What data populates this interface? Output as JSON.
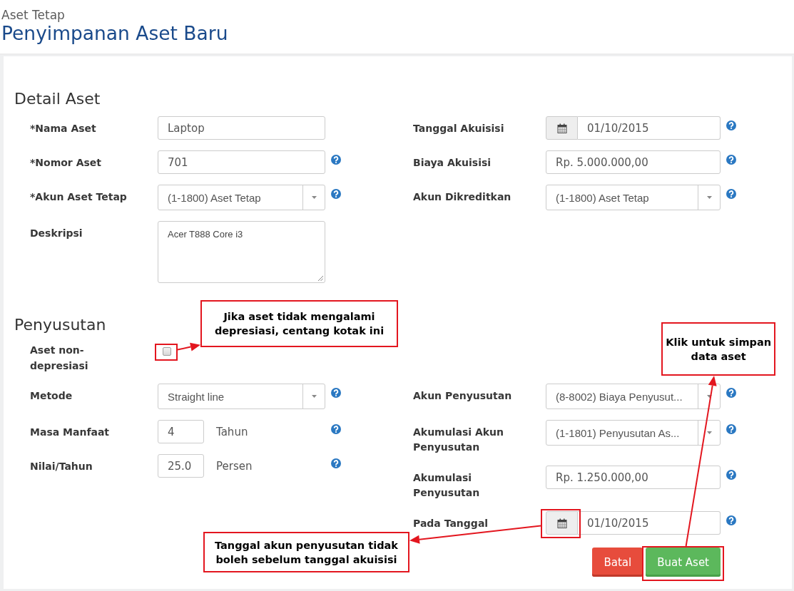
{
  "header": {
    "breadcrumb": "Aset Tetap",
    "title": "Penyimpanan Aset Baru"
  },
  "sections": [
    {
      "title": "Detail Aset",
      "columns": [
        [
          {
            "kind": "text",
            "label": "*Nama Aset",
            "value": "Laptop",
            "help": false
          },
          {
            "kind": "text",
            "label": "*Nomor Aset",
            "value": "701",
            "help": true
          },
          {
            "kind": "select",
            "label": "*Akun Aset Tetap",
            "value": "(1-1800) Aset Tetap",
            "help": true
          },
          {
            "kind": "textarea",
            "label": "Deskripsi",
            "value": "Acer T888 Core i3",
            "help": false
          }
        ],
        [
          {
            "kind": "date",
            "label": "Tanggal Akuisisi",
            "value": "01/10/2015",
            "help": true
          },
          {
            "kind": "text",
            "label": "Biaya Akuisisi",
            "value": "Rp. 5.000.000,00",
            "help": true
          },
          {
            "kind": "select",
            "label": "Akun Dikreditkan",
            "value": "(1-1800) Aset Tetap",
            "help": true
          }
        ]
      ]
    },
    {
      "title": "Penyusutan",
      "toggle": {
        "label": "Aset non-depresiasi",
        "checked": false,
        "callout": "Jika aset tidak mengalami depresiasi, centang kotak ini"
      },
      "columns": [
        [
          {
            "kind": "select",
            "label": "Metode",
            "value": "Straight line",
            "help": true
          },
          {
            "kind": "unit",
            "label": "Masa Manfaat",
            "value": "4",
            "unit": "Tahun",
            "help": true
          },
          {
            "kind": "unit",
            "label": "Nilai/Tahun",
            "value": "25.0",
            "unit": "Persen",
            "help": true
          }
        ],
        [
          {
            "kind": "select",
            "label": "Akun Penyusutan",
            "value": "(8-8002) Biaya Penyusut...",
            "help": true
          },
          {
            "kind": "select",
            "label": "Akumulasi Akun Penyusutan",
            "value": "(1-1801) Penyusutan As...",
            "help": true
          },
          {
            "kind": "text",
            "label": "Akumulasi Penyusutan",
            "value": "Rp. 1.250.000,00",
            "help": true
          },
          {
            "kind": "date",
            "label": "Pada Tanggal",
            "value": "01/10/2015",
            "help": true,
            "callout": "Tanggal akun penyusutan tidak boleh sebelum tanggal akuisisi"
          }
        ]
      ]
    }
  ],
  "buttons": [
    {
      "kind": "danger",
      "label": "Batal"
    },
    {
      "kind": "success",
      "label": "Buat Aset",
      "callout": "Klik untuk simpan data aset"
    }
  ]
}
